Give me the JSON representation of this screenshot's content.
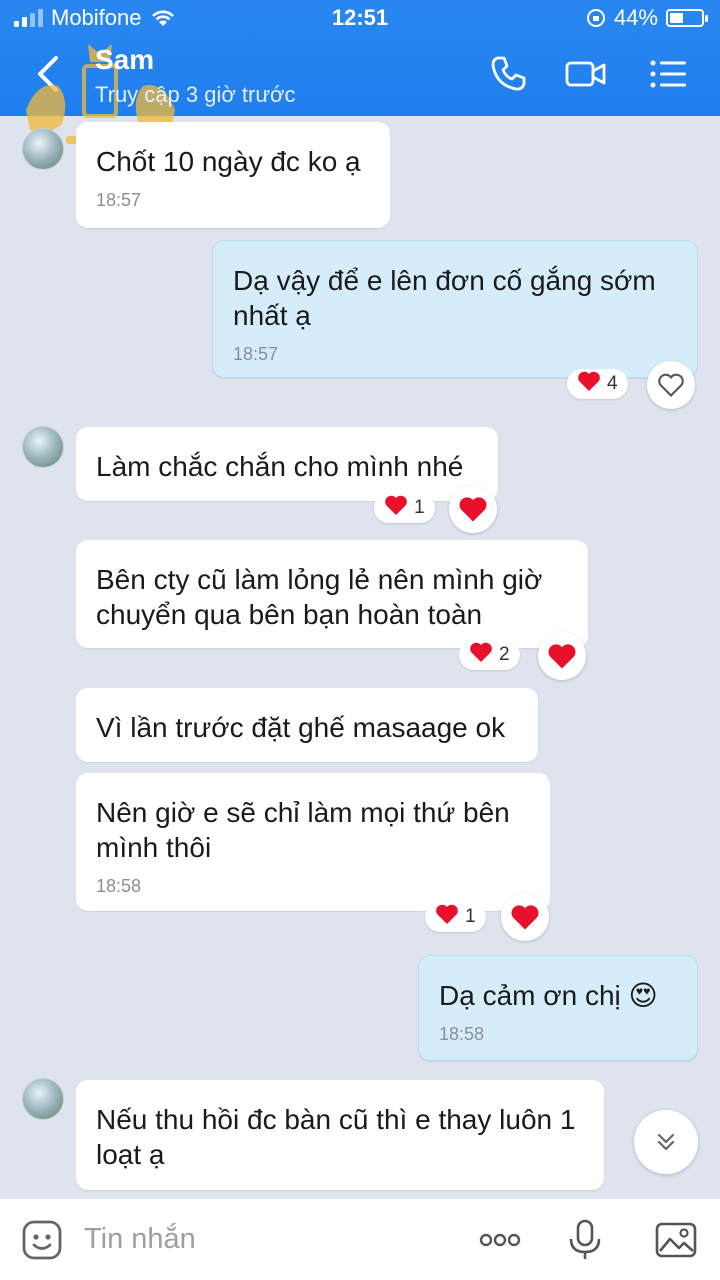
{
  "status_bar": {
    "carrier": "Mobifone",
    "time": "12:51",
    "battery_percent_text": "44%",
    "battery_level": 0.44
  },
  "header": {
    "contact_name": "Sam",
    "contact_status": "Truy cập 3 giờ trước"
  },
  "colors": {
    "header_bg": "#2080ee",
    "chat_bg": "#dfe3ee",
    "outgoing_bubble": "#d5ecfb",
    "heart": "#e8102b"
  },
  "messages": [
    {
      "text": "Chốt 10 ngày đc ko ạ",
      "time": "18:57"
    },
    {
      "text": "Dạ vậy để e lên đơn cố gắng sớm nhất ạ",
      "time": "18:57",
      "reaction_count": "4"
    },
    {
      "text": "Làm chắc chắn cho mình nhé",
      "reaction_count": "1"
    },
    {
      "text": "Bên cty cũ làm lỏng lẻ nên mình giờ chuyển qua bên bạn hoàn toàn",
      "reaction_count": "2"
    },
    {
      "text": "Vì lần trước đặt ghế masaage ok"
    },
    {
      "text": "Nên giờ e sẽ chỉ làm mọi thứ bên mình thôi",
      "time": "18:58",
      "reaction_count": "1"
    },
    {
      "text": "Dạ cảm ơn chị",
      "emoji": "😍",
      "time": "18:58"
    },
    {
      "text": "Nếu thu hồi đc bàn cũ thì e thay luôn 1 loạt ạ"
    }
  ],
  "input": {
    "placeholder": "Tin nhắn"
  },
  "icons": [
    "back-icon",
    "phone-icon",
    "video-call-icon",
    "menu-icon",
    "heart-icon",
    "heart-outline-icon",
    "chevron-double-down-icon",
    "sticker-icon",
    "more-icon",
    "microphone-icon",
    "image-icon"
  ]
}
